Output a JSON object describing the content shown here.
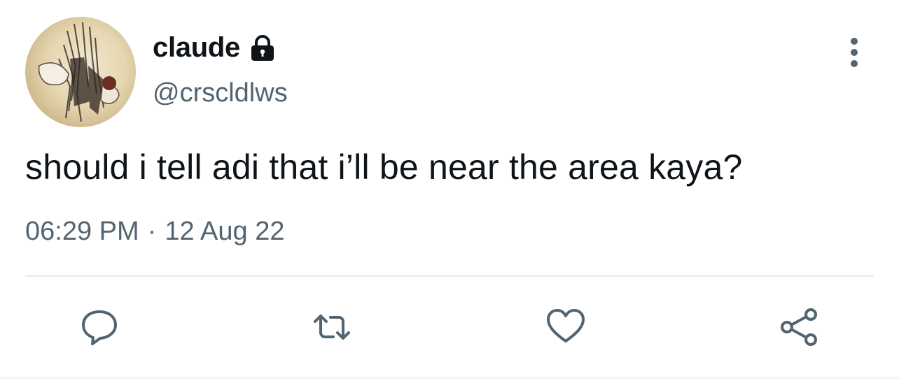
{
  "tweet": {
    "display_name": "claude",
    "handle": "@crscldlws",
    "text": "should i tell adi that i’ll be near the area kaya?",
    "time": "06:29 PM",
    "separator": "·",
    "date": "12 Aug 22"
  },
  "icons": {
    "lock": "lock-icon",
    "more": "more-vertical-icon",
    "reply": "reply-icon",
    "retweet": "retweet-icon",
    "like": "heart-icon",
    "share": "share-icon"
  },
  "colors": {
    "text_primary": "#0f1419",
    "text_secondary": "#536471",
    "divider": "#e6ebee"
  }
}
